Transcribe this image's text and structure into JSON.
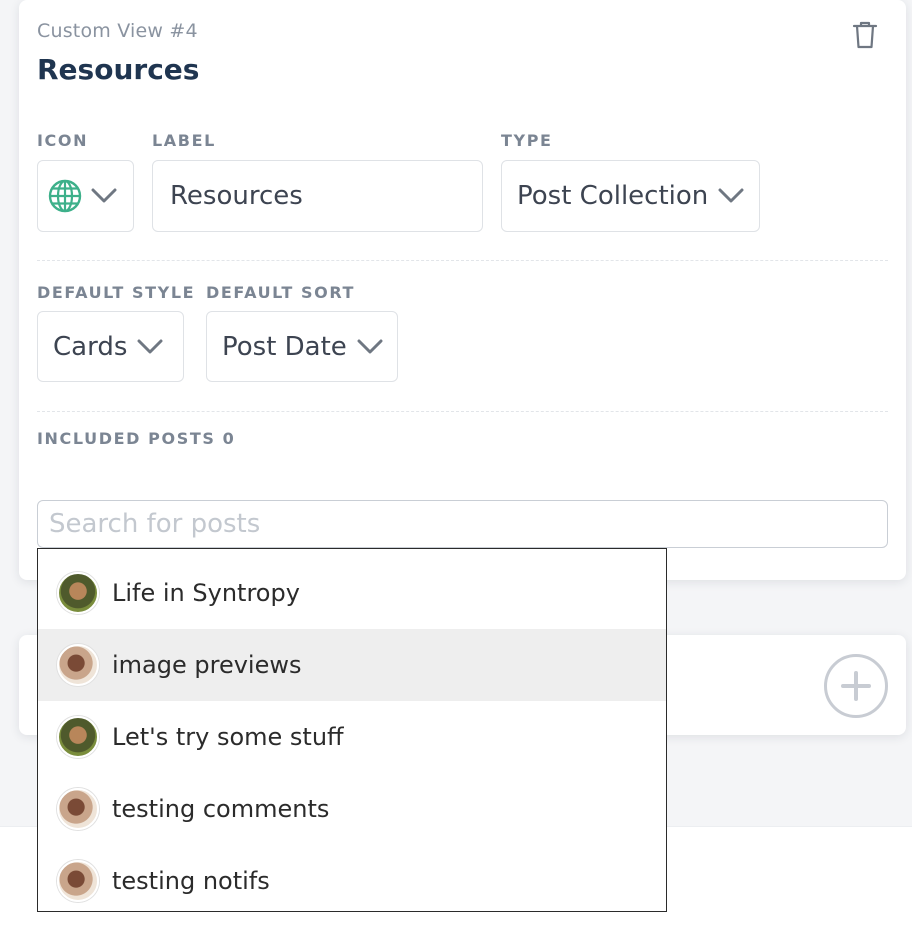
{
  "view": {
    "subtitle": "Custom View #4",
    "title": "Resources",
    "delete_icon": "trash-icon"
  },
  "fields": {
    "icon_label": "ICON",
    "icon_value": "globe-icon",
    "label_label": "LABEL",
    "label_value": "Resources",
    "type_label": "TYPE",
    "type_value": "Post Collection",
    "style_label": "DEFAULT STYLE",
    "style_value": "Cards",
    "sort_label": "DEFAULT SORT",
    "sort_value": "Post Date"
  },
  "included_posts": {
    "label": "INCLUDED POSTS 0",
    "search_placeholder": "Search for posts"
  },
  "suggestions": [
    {
      "title": "Life in Syntropy",
      "avatar": "avatar-a"
    },
    {
      "title": "image previews",
      "avatar": "avatar-b",
      "highlighted": true
    },
    {
      "title": "Let's try some stuff",
      "avatar": "avatar-a"
    },
    {
      "title": "testing comments",
      "avatar": "avatar-b"
    },
    {
      "title": "testing notifs",
      "avatar": "avatar-b"
    }
  ],
  "add_view_icon": "plus-circle-icon",
  "colors": {
    "title": "#1f3550",
    "globe": "#3db08a",
    "muted": "#7b8593",
    "highlight": "#eeeeee"
  }
}
